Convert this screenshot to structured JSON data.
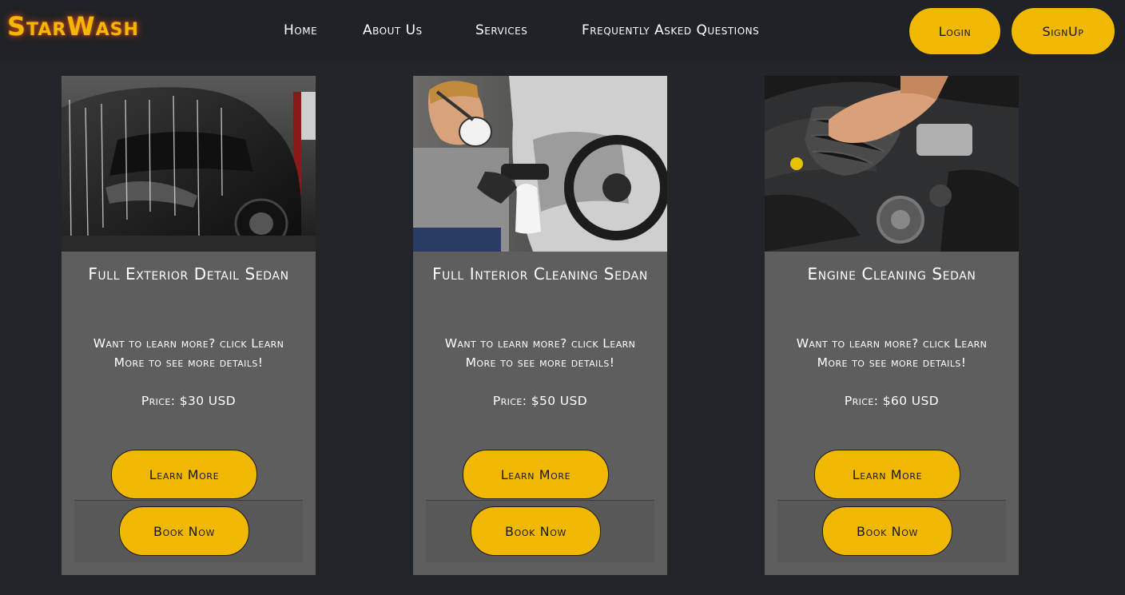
{
  "brand": "StarWash",
  "nav": {
    "home": "Home",
    "about": "About Us",
    "services": "Services",
    "faq": "Frequently Asked Questions"
  },
  "auth": {
    "login": "Login",
    "signup": "SignUp"
  },
  "colors": {
    "accent": "#f0b800",
    "background": "#22262b",
    "card": "#5e5e5e"
  },
  "cards": [
    {
      "title": "Full Exterior Detail Sedan",
      "description": "Want to learn more? click Learn More to see more details!",
      "price": "Price: $30 USD",
      "learn_more": "Learn More",
      "book_now": "Book Now"
    },
    {
      "title": "Full Interior Cleaning Sedan",
      "description": "Want to learn more? click Learn More to see more details!",
      "price": "Price: $50 USD",
      "learn_more": "Learn More",
      "book_now": "Book Now"
    },
    {
      "title": "Engine Cleaning Sedan",
      "description": "Want to learn more? click Learn More to see more details!",
      "price": "Price: $60 USD",
      "learn_more": "Learn More",
      "book_now": "Book Now"
    }
  ]
}
